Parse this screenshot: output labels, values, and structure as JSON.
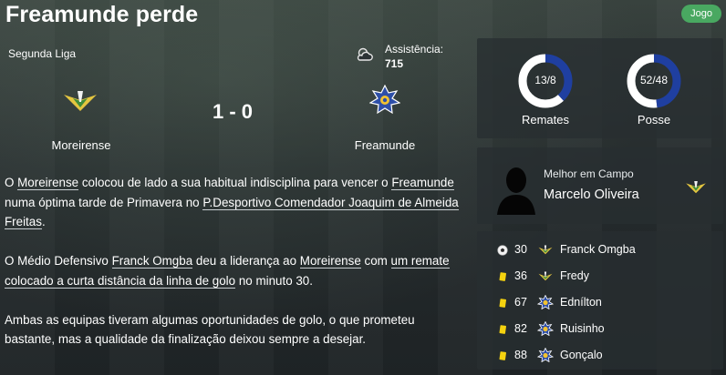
{
  "header": {
    "title": "Freamunde perde",
    "badge": "Jogo"
  },
  "match": {
    "competition": "Segunda Liga",
    "attendance_label": "Assistência:",
    "attendance_value": "715",
    "score": "1 - 0",
    "home_team": "Moreirense",
    "away_team": "Freamunde",
    "weather_icon": "cloudy-icon"
  },
  "report": {
    "p1": [
      {
        "t": "O ",
        "link": false
      },
      {
        "t": "Moreirense",
        "link": true
      },
      {
        "t": " colocou de lado a sua habitual indisciplina para vencer o ",
        "link": false
      },
      {
        "t": "Freamunde",
        "link": true
      },
      {
        "t": " numa óptima tarde de Primavera no ",
        "link": false
      },
      {
        "t": "P.Desportivo Comendador Joaquim de Almeida Freitas",
        "link": true
      },
      {
        "t": ".",
        "link": false
      }
    ],
    "p2": [
      {
        "t": "O Médio Defensivo ",
        "link": false
      },
      {
        "t": "Franck Omgba",
        "link": true
      },
      {
        "t": " deu a liderança ao ",
        "link": false
      },
      {
        "t": "Moreirense",
        "link": true
      },
      {
        "t": " com ",
        "link": false
      },
      {
        "t": "um remate colocado a curta distância da linha de golo",
        "link": true
      },
      {
        "t": " no minuto 30.",
        "link": false
      }
    ],
    "p3": [
      {
        "t": "Ambas as equipas tiveram algumas oportunidades de golo, o que prometeu bastante, mas a qualidade da finalização deixou sempre a desejar.",
        "link": false
      }
    ]
  },
  "stats": {
    "shots": {
      "value": "13/8",
      "label": "Remates",
      "home": 13,
      "away": 8
    },
    "possession": {
      "value": "52/48",
      "label": "Posse",
      "home": 52,
      "away": 48
    },
    "colors": {
      "home": "#ffffff",
      "away": "#1f3fa0"
    }
  },
  "motm": {
    "label": "Melhor em Campo",
    "name": "Marcelo Oliveira"
  },
  "events": [
    {
      "minute": "30",
      "type": "goal",
      "icon": "ball-icon",
      "team": "home",
      "player": "Franck Omgba"
    },
    {
      "minute": "36",
      "type": "yellow-card",
      "icon": "yellow-card-icon",
      "team": "home",
      "player": "Fredy"
    },
    {
      "minute": "67",
      "type": "yellow-card",
      "icon": "yellow-card-icon",
      "team": "away",
      "player": "Ednílton"
    },
    {
      "minute": "82",
      "type": "yellow-card",
      "icon": "yellow-card-icon",
      "team": "away",
      "player": "Ruisinho"
    },
    {
      "minute": "88",
      "type": "yellow-card",
      "icon": "yellow-card-icon",
      "team": "away",
      "player": "Gonçalo"
    }
  ]
}
